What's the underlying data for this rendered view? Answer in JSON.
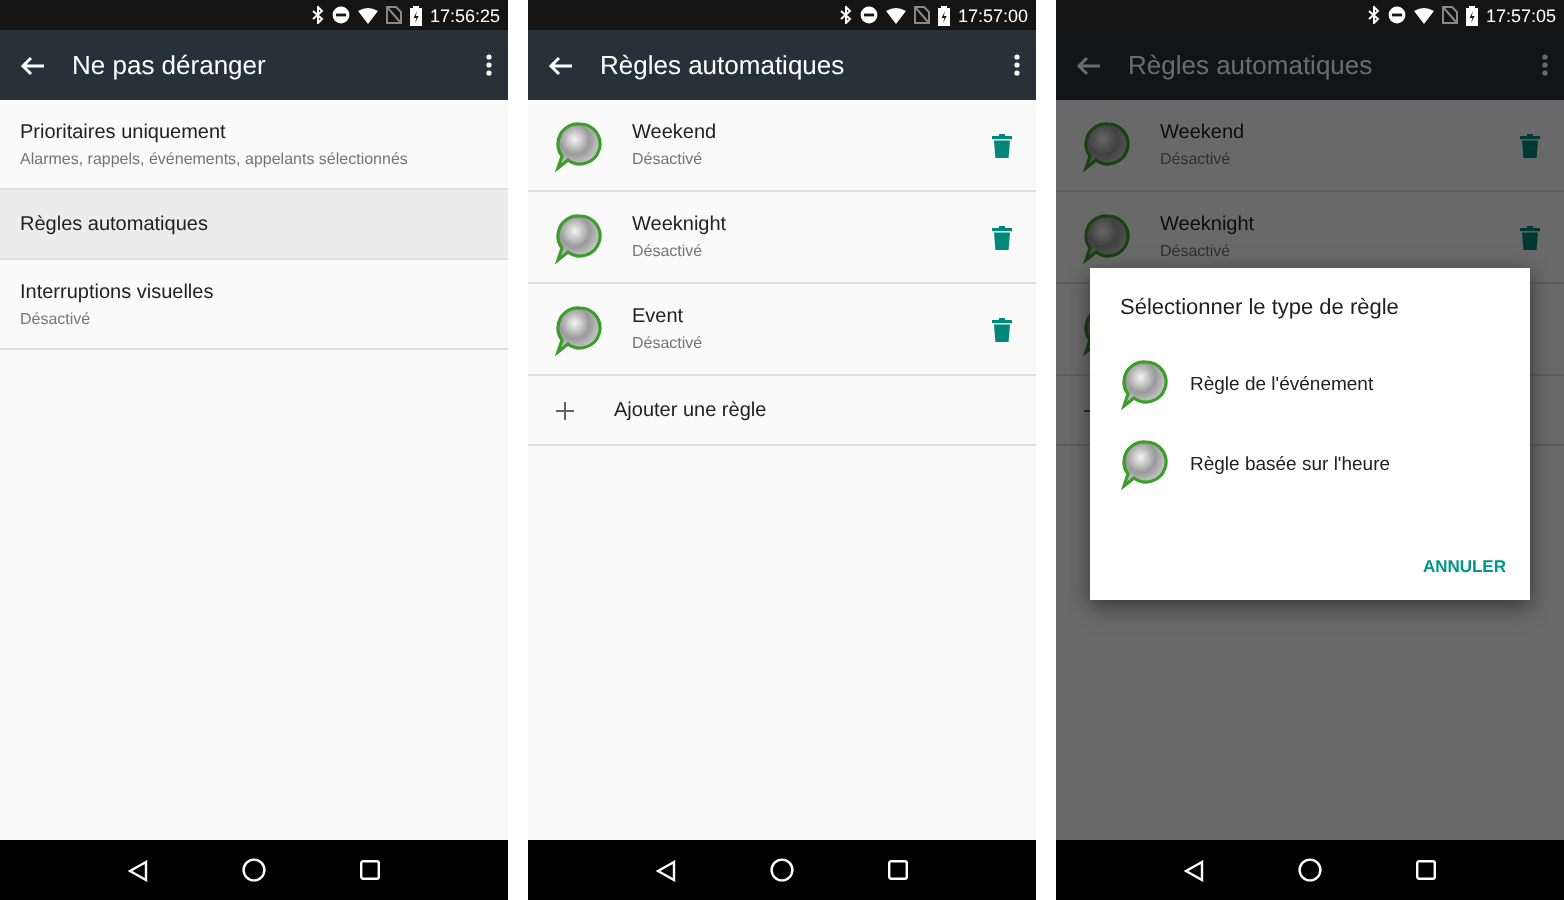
{
  "screens": [
    {
      "time": "17:56:25",
      "title": "Ne pas déranger",
      "dimmed": false,
      "items": [
        {
          "kind": "setting",
          "title": "Prioritaires uniquement",
          "subtitle": "Alarmes, rappels, événements, appelants sélectionnés",
          "selected": false
        },
        {
          "kind": "setting",
          "title": "Règles automatiques",
          "selected": true
        },
        {
          "kind": "setting",
          "title": "Interruptions visuelles",
          "subtitle": "Désactivé",
          "selected": false
        }
      ]
    },
    {
      "time": "17:57:00",
      "title": "Règles automatiques",
      "dimmed": false,
      "items": [
        {
          "kind": "rule",
          "name": "Weekend",
          "status": "Désactivé"
        },
        {
          "kind": "rule",
          "name": "Weeknight",
          "status": "Désactivé"
        },
        {
          "kind": "rule",
          "name": "Event",
          "status": "Désactivé"
        },
        {
          "kind": "add",
          "label": "Ajouter une règle"
        }
      ]
    },
    {
      "time": "17:57:05",
      "title": "Règles automatiques",
      "dimmed": true,
      "items": [
        {
          "kind": "rule",
          "name": "Weekend",
          "status": "Désactivé"
        },
        {
          "kind": "rule",
          "name": "Weeknight",
          "status": "Désactivé"
        },
        {
          "kind": "rule"
        },
        {
          "kind": "add"
        }
      ],
      "dialog": {
        "title": "Sélectionner le type de règle",
        "options": [
          "Règle de l'événement",
          "Règle basée sur l'heure"
        ],
        "button": "ANNULER"
      }
    }
  ]
}
